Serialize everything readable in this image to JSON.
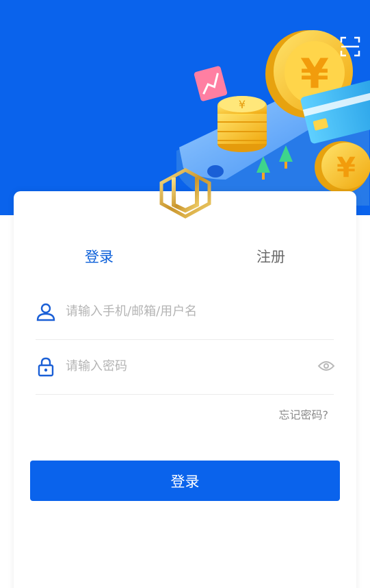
{
  "tabs": {
    "login": "登录",
    "register": "注册"
  },
  "fields": {
    "account_placeholder": "请输入手机/邮箱/用户名",
    "password_placeholder": "请输入密码"
  },
  "forgot_password": "忘记密码?",
  "login_button": "登录",
  "hero_coin_symbol": "¥",
  "icons": {
    "scan": "scan-icon",
    "user": "user-icon",
    "lock": "lock-icon",
    "eye": "eye-icon",
    "logo": "brand-logo"
  },
  "colors": {
    "primary": "#0a63ec",
    "active_tab": "#0b5fd9",
    "gold": "#f5b91c"
  }
}
